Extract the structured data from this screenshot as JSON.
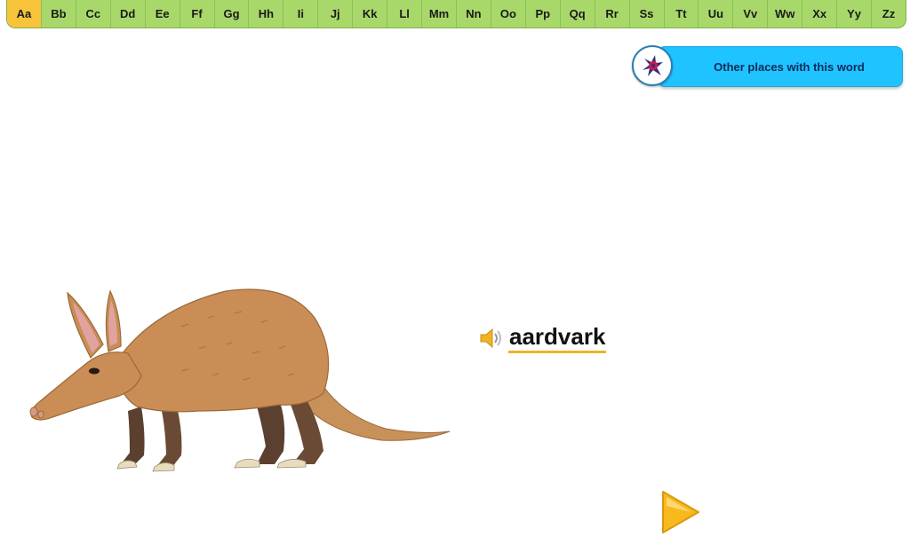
{
  "alphabet": {
    "letters": [
      "Aa",
      "Bb",
      "Cc",
      "Dd",
      "Ee",
      "Ff",
      "Gg",
      "Hh",
      "Ii",
      "Jj",
      "Kk",
      "Ll",
      "Mm",
      "Nn",
      "Oo",
      "Pp",
      "Qq",
      "Rr",
      "Ss",
      "Tt",
      "Uu",
      "Vv",
      "Ww",
      "Xx",
      "Yy",
      "Zz"
    ],
    "active": "Aa"
  },
  "places_button": {
    "label": "Other places with this word",
    "icon": "map-pin-icon"
  },
  "word": {
    "text": "aardvark",
    "speaker_icon": "speaker-icon"
  },
  "illustration": {
    "subject": "aardvark"
  },
  "navigation": {
    "next_icon": "play-arrow-icon"
  },
  "colors": {
    "alphabet_bar": "#a9d86a",
    "alphabet_active": "#f7c33b",
    "places_button": "#1fc3ff",
    "word_underline": "#f0b323",
    "next_arrow": "#f7b91c"
  }
}
